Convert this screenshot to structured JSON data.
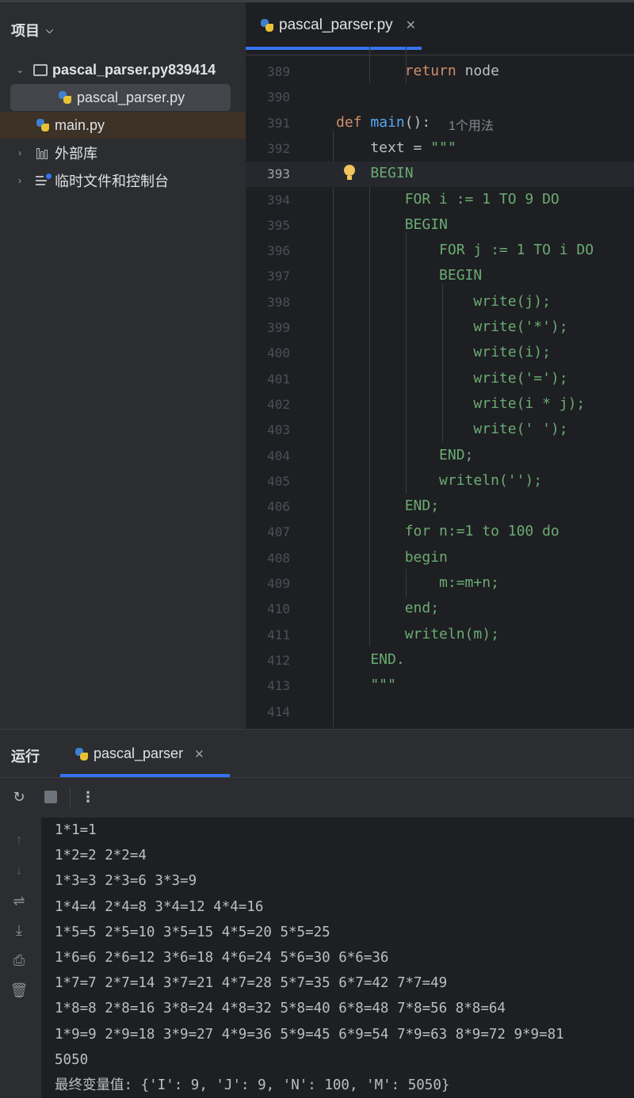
{
  "project_panel": {
    "title": "项目",
    "tree": [
      {
        "label": "pascal_parser.py839414",
        "type": "folder",
        "expanded": true
      },
      {
        "label": "pascal_parser.py",
        "type": "python-file",
        "selected": true
      },
      {
        "label": "main.py",
        "type": "python-file"
      },
      {
        "label": "外部库",
        "type": "library"
      },
      {
        "label": "临时文件和控制台",
        "type": "scratches"
      }
    ]
  },
  "editor": {
    "tab_label": "pascal_parser.py",
    "current_line": "393",
    "lines": [
      {
        "n": "389",
        "code": "        return node"
      },
      {
        "n": "390",
        "code": ""
      },
      {
        "n": "391",
        "code": "def main():",
        "hint": "1个用法"
      },
      {
        "n": "392",
        "code": "    text = \"\"\""
      },
      {
        "n": "393",
        "code": "    BEGIN"
      },
      {
        "n": "394",
        "code": "        FOR i := 1 TO 9 DO"
      },
      {
        "n": "395",
        "code": "        BEGIN"
      },
      {
        "n": "396",
        "code": "            FOR j := 1 TO i DO"
      },
      {
        "n": "397",
        "code": "            BEGIN"
      },
      {
        "n": "398",
        "code": "                write(j);"
      },
      {
        "n": "399",
        "code": "                write('*');"
      },
      {
        "n": "400",
        "code": "                write(i);"
      },
      {
        "n": "401",
        "code": "                write('=');"
      },
      {
        "n": "402",
        "code": "                write(i * j);"
      },
      {
        "n": "403",
        "code": "                write(' ');"
      },
      {
        "n": "404",
        "code": "            END;"
      },
      {
        "n": "405",
        "code": "            writeln('');"
      },
      {
        "n": "406",
        "code": "        END;"
      },
      {
        "n": "407",
        "code": "        for n:=1 to 100 do"
      },
      {
        "n": "408",
        "code": "        begin"
      },
      {
        "n": "409",
        "code": "            m:=m+n;"
      },
      {
        "n": "410",
        "code": "        end;"
      },
      {
        "n": "411",
        "code": "        writeln(m);"
      },
      {
        "n": "412",
        "code": "    END."
      },
      {
        "n": "413",
        "code": "    \"\"\""
      },
      {
        "n": "414",
        "code": ""
      }
    ]
  },
  "run_panel": {
    "title": "运行",
    "tab_label": "pascal_parser",
    "output": [
      "1*1=1",
      "1*2=2 2*2=4",
      "1*3=3 2*3=6 3*3=9",
      "1*4=4 2*4=8 3*4=12 4*4=16",
      "1*5=5 2*5=10 3*5=15 4*5=20 5*5=25",
      "1*6=6 2*6=12 3*6=18 4*6=24 5*6=30 6*6=36",
      "1*7=7 2*7=14 3*7=21 4*7=28 5*7=35 6*7=42 7*7=49",
      "1*8=8 2*8=16 3*8=24 4*8=32 5*8=40 6*8=48 7*8=56 8*8=64",
      "1*9=9 2*9=18 3*9=27 4*9=36 5*9=45 6*9=54 7*9=63 8*9=72 9*9=81",
      "5050",
      "最终变量值: {'I': 9, 'J': 9, 'N': 100, 'M': 5050}"
    ]
  }
}
